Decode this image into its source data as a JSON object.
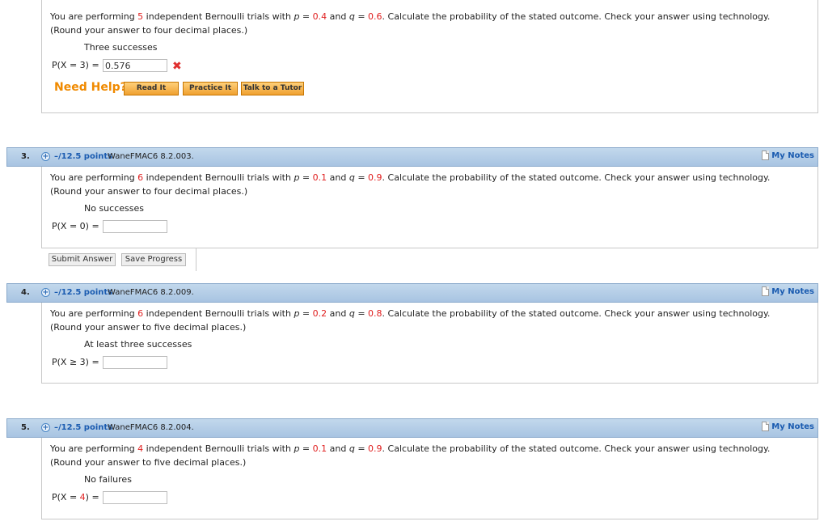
{
  "q2": {
    "text_parts": [
      "You are performing ",
      "5",
      " independent Bernoulli trials with ",
      "p",
      " = ",
      "0.4",
      " and ",
      "q",
      " = ",
      "0.6",
      ". Calculate the probability of the stated outcome. Check your answer using technology. (Round your answer to four decimal places.)"
    ],
    "outcome": "Three successes",
    "answer_label": "P(X = 3) =",
    "answer_value": "0.576",
    "status_icon": "x-icon",
    "need_help": "Need Help?",
    "help_buttons": [
      "Read It",
      "Practice It",
      "Talk to a Tutor"
    ]
  },
  "q3": {
    "number": "3.",
    "points": "–/12.5 points",
    "source": "WaneFMAC6 8.2.003.",
    "my_notes": "My Notes",
    "text_parts": [
      "You are performing ",
      "6",
      " independent Bernoulli trials with ",
      "p",
      " = ",
      "0.1",
      " and ",
      "q",
      " = ",
      "0.9",
      ". Calculate the probability of the stated outcome. Check your answer using technology. (Round your answer to four decimal places.)"
    ],
    "outcome": "No successes",
    "answer_label": "P(X = 0) =",
    "answer_value": "",
    "submit_label": "Submit Answer",
    "save_label": "Save Progress"
  },
  "q4": {
    "number": "4.",
    "points": "–/12.5 points",
    "source": "WaneFMAC6 8.2.009.",
    "my_notes": "My Notes",
    "text_parts": [
      "You are performing ",
      "6",
      " independent Bernoulli trials with ",
      "p",
      " = ",
      "0.2",
      " and ",
      "q",
      " = ",
      "0.8",
      ". Calculate the probability of the stated outcome. Check your answer using technology. (Round your answer to five decimal places.)"
    ],
    "outcome": "At least three successes",
    "answer_label": "P(X ≥ 3) =",
    "answer_value": ""
  },
  "q5": {
    "number": "5.",
    "points": "–/12.5 points",
    "source": "WaneFMAC6 8.2.004.",
    "my_notes": "My Notes",
    "text_parts": [
      "You are performing ",
      "4",
      " independent Bernoulli trials with ",
      "p",
      " = ",
      "0.1",
      " and ",
      "q",
      " = ",
      "0.9",
      ". Calculate the probability of the stated outcome. Check your answer using technology. (Round your answer to five decimal places.)"
    ],
    "outcome": "No failures",
    "answer_label_parts": [
      "P(X = ",
      "4",
      ") ="
    ],
    "answer_value": ""
  },
  "colors": {
    "accent_red": "#e02020",
    "header_blue": "#b4cde6",
    "link_blue": "#1a5bb0",
    "help_orange": "#f08a00"
  }
}
